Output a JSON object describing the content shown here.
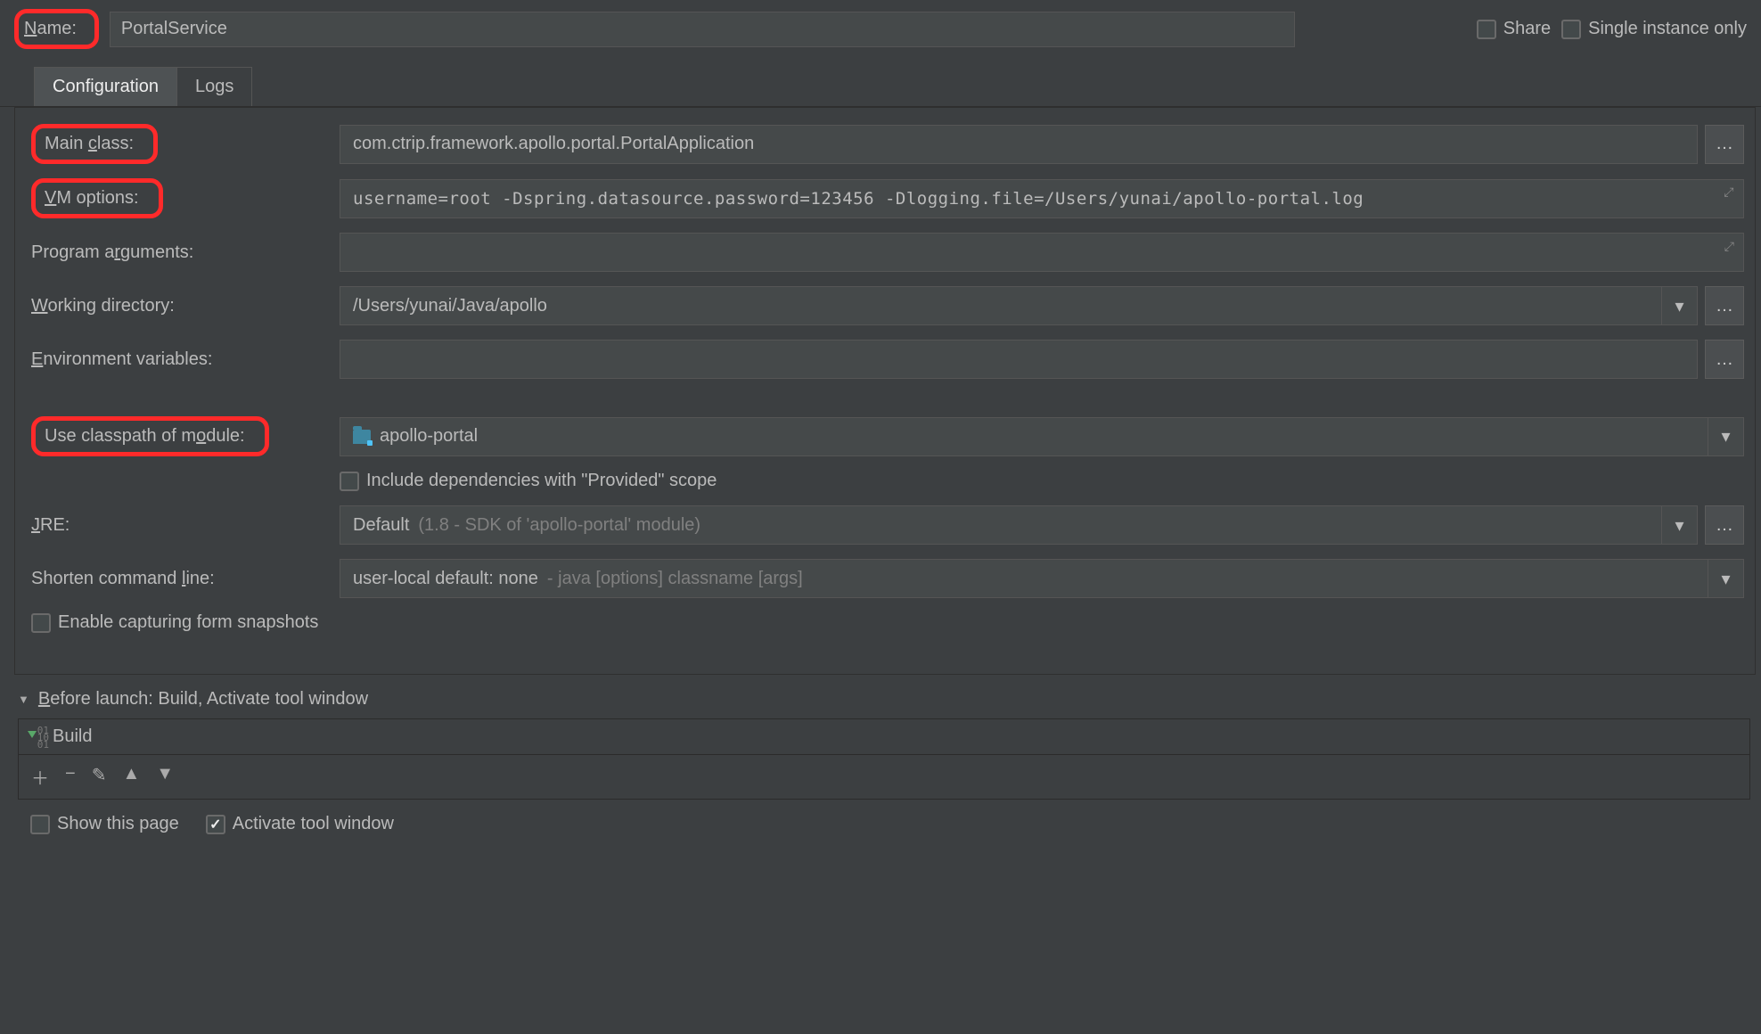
{
  "top": {
    "name_label_pre": "N",
    "name_label_post": "ame:",
    "name_value": "PortalService",
    "share_label": "Share",
    "single_instance_label": "Single instance only"
  },
  "tabs": {
    "configuration": "Configuration",
    "logs": "Logs"
  },
  "fields": {
    "main_class": {
      "label_pre": "Main ",
      "label_u": "c",
      "label_post": "lass:",
      "value": "com.ctrip.framework.apollo.portal.PortalApplication"
    },
    "vm_options": {
      "label_u": "V",
      "label_post": "M options:",
      "value": "username=root -Dspring.datasource.password=123456 -Dlogging.file=/Users/yunai/apollo-portal.log"
    },
    "program_args": {
      "label_pre": "Program a",
      "label_u": "r",
      "label_post": "guments:",
      "value": ""
    },
    "working_dir": {
      "label_u": "W",
      "label_post": "orking directory:",
      "value": "/Users/yunai/Java/apollo"
    },
    "env_vars": {
      "label_u": "E",
      "label_post": "nvironment variables:",
      "value": ""
    },
    "classpath": {
      "label_pre": "Use classpath of m",
      "label_u": "o",
      "label_post": "dule:",
      "value": "apollo-portal"
    },
    "provided_scope": "Include dependencies with \"Provided\" scope",
    "jre": {
      "label_u": "J",
      "label_post": "RE:",
      "value_main": "Default ",
      "value_dim": "(1.8 - SDK of 'apollo-portal' module)"
    },
    "shorten": {
      "label_pre": "Shorten command ",
      "label_u": "l",
      "label_post": "ine:",
      "value_main": "user-local default: none ",
      "value_dim": "- java [options] classname [args]"
    },
    "snapshots": "Enable capturing form snapshots"
  },
  "before_launch": {
    "header_pre": "B",
    "header_post": "efore launch: Build, Activate tool window",
    "build_item": "Build"
  },
  "bottom": {
    "show_page": "Show this page",
    "activate_tool": "Activate tool window"
  }
}
